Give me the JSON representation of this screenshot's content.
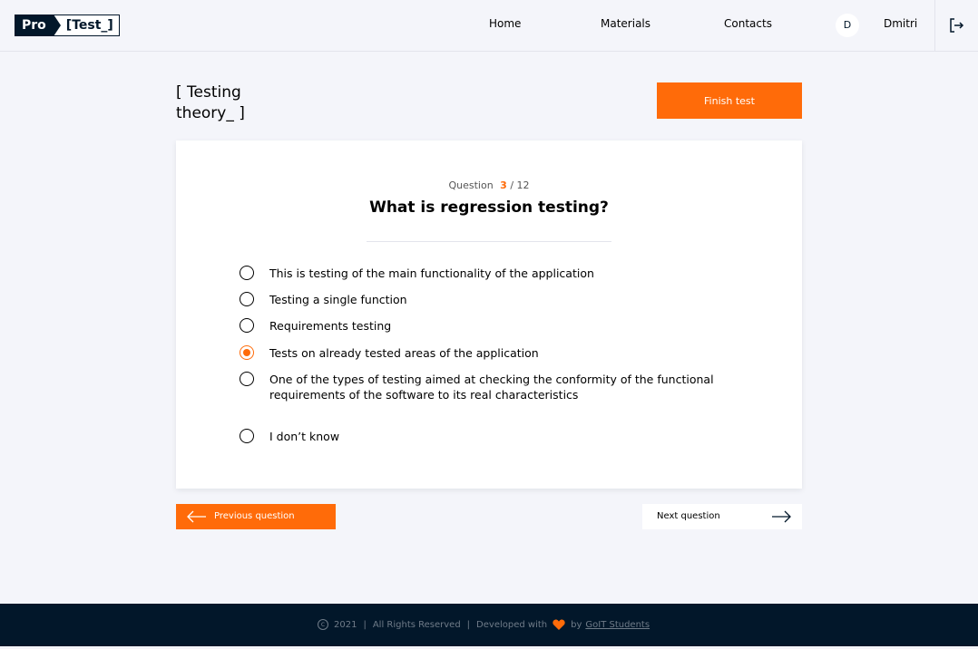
{
  "header": {
    "logo_pro": "Pro",
    "logo_test": "[Test_]",
    "nav": [
      "Home",
      "Materials",
      "Contacts"
    ],
    "user_initial": "D",
    "user_name": "Dmitri"
  },
  "main": {
    "title": "[ Testing\ntheory_ ]",
    "finish_label": "Finish test",
    "question": {
      "counter_label": "Question",
      "current": "3",
      "total": "/ 12",
      "text": "What is regression testing?",
      "answers": [
        "This is testing of the main functionality of the application",
        "Testing a single function",
        "Requirements testing",
        "Tests on already tested areas of the application",
        "One of the types of testing aimed at checking the conformity of the functional requirements of the software to its real characteristics",
        "I don’t know"
      ],
      "selected_index": 3
    },
    "prev_label": "Previous question",
    "next_label": "Next question"
  },
  "footer": {
    "year": "2021",
    "rights": "All Rights Reserved",
    "developed": "Developed with",
    "by": "by",
    "team": "GoIT Students"
  },
  "colors": {
    "accent": "#ff6b09",
    "dark": "#02172a",
    "background": "#f4f5fa"
  }
}
